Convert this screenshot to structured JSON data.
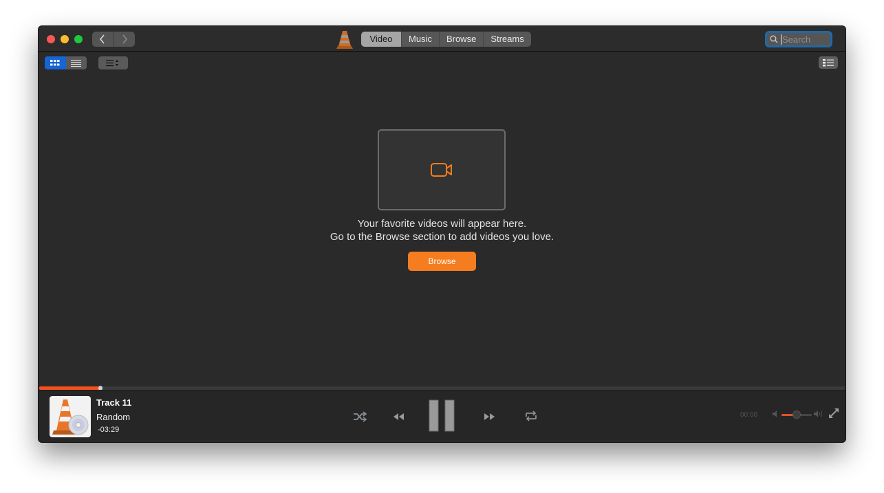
{
  "window": {
    "nav": {
      "back_icon": "chevron-left-icon",
      "forward_icon": "chevron-right-icon"
    },
    "tabs": [
      {
        "label": "Video",
        "active": true
      },
      {
        "label": "Music",
        "active": false
      },
      {
        "label": "Browse",
        "active": false
      },
      {
        "label": "Streams",
        "active": false
      }
    ],
    "search": {
      "placeholder": "Search",
      "value": ""
    }
  },
  "toolbar": {
    "view_modes": [
      {
        "name": "grid",
        "icon": "grid-icon",
        "active": true
      },
      {
        "name": "list",
        "icon": "list-icon",
        "active": false
      }
    ],
    "sort_icon": "sort-icon",
    "info_icon": "info-panel-icon"
  },
  "empty_state": {
    "icon": "video-camera-icon",
    "line1": "Your favorite videos will appear here.",
    "line2": "Go to the Browse section to add videos you love.",
    "button_label": "Browse"
  },
  "player": {
    "progress_fraction": 0.076,
    "track_title": "Track 11",
    "artist": "Random",
    "remaining_time": "-03:29",
    "elapsed_time": "00:00",
    "volume_fraction": 0.5,
    "state": "playing"
  },
  "colors": {
    "accent": "#f57d1f",
    "progress": "#f4501e",
    "selection_blue": "#1764d4",
    "search_focus": "#1f6aa7"
  }
}
